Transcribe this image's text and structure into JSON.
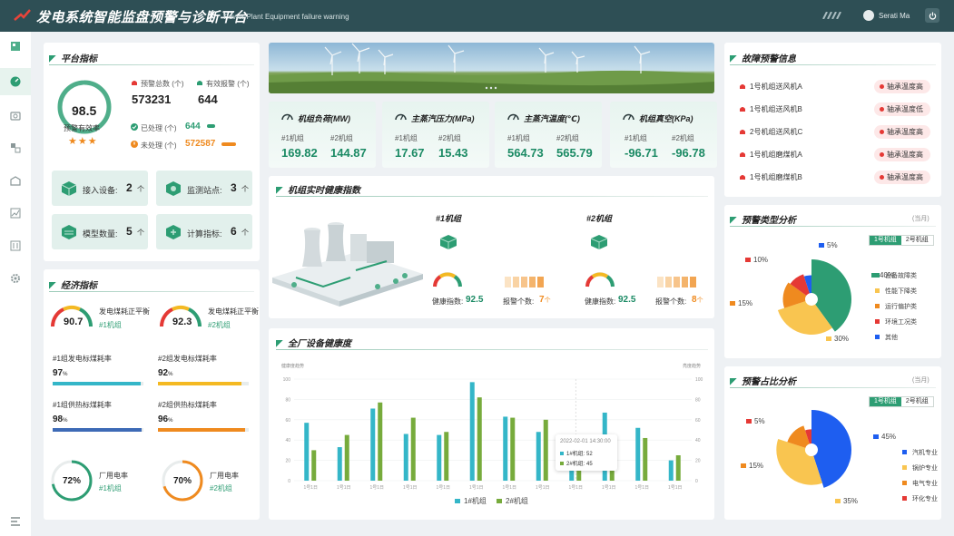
{
  "header": {
    "title": "发电系统智能监盘预警与诊断平台",
    "subtitle": "-Power Plant Equipment failure warning",
    "user": "Serati Ma"
  },
  "sidebar": {
    "icons": [
      "logo-icon",
      "dashboard-icon",
      "camera-icon",
      "flow-icon",
      "chart-icon",
      "trend-icon",
      "report-icon",
      "settings-icon",
      "menu-icon"
    ]
  },
  "platform": {
    "title": "平台指标",
    "gauge_value": "98.5",
    "gauge_label": "预警有效率",
    "stars": "★★★",
    "total_label": "预警总数 (个)",
    "total_value": "573231",
    "valid_label": "有效报警 (个)",
    "valid_value": "644",
    "handled_label": "已处理 (个)",
    "handled_value": "644",
    "unhandled_label": "未处理 (个)",
    "unhandled_value": "572587",
    "tiles": [
      {
        "label": "接入设备:",
        "value": "2",
        "unit": "个"
      },
      {
        "label": "监测站点:",
        "value": "3",
        "unit": "个"
      },
      {
        "label": "模型数量:",
        "value": "5",
        "unit": "个"
      },
      {
        "label": "计算指标:",
        "value": "6",
        "unit": "个"
      }
    ]
  },
  "economy": {
    "title": "经济指标",
    "gauges": [
      {
        "value": "90.7",
        "label": "发电煤耗正平衡",
        "unit_label": "#1机组"
      },
      {
        "value": "92.3",
        "label": "发电煤耗正平衡",
        "unit_label": "#2机组"
      }
    ],
    "bars": [
      {
        "label": "#1组发电标煤耗率",
        "value": "97",
        "unit": "%",
        "pct": 97,
        "color": "#34b6c8"
      },
      {
        "label": "#2组发电标煤耗率",
        "value": "92",
        "unit": "%",
        "pct": 92,
        "color": "#f4b922"
      },
      {
        "label": "#1组供热标煤耗率",
        "value": "98",
        "unit": "%",
        "pct": 98,
        "color": "#3d6ab6"
      },
      {
        "label": "#2组供热标煤耗率",
        "value": "96",
        "unit": "%",
        "pct": 96,
        "color": "#ef8a1f"
      }
    ],
    "rings": [
      {
        "value": "72%",
        "pct": 72,
        "label": "厂用电率",
        "unit_label": "#1机组",
        "color": "#2d9d73"
      },
      {
        "value": "70%",
        "pct": 70,
        "label": "厂用电率",
        "unit_label": "#2机组",
        "color": "#ef8a1f"
      }
    ]
  },
  "metrics": [
    {
      "title": "机组负荷(MW)",
      "u1": "#1机组",
      "v1": "169.82",
      "u2": "#2机组",
      "v2": "144.87"
    },
    {
      "title": "主蒸汽压力(MPa)",
      "u1": "#1机组",
      "v1": "17.67",
      "u2": "#2机组",
      "v2": "15.43"
    },
    {
      "title": "主蒸汽温度(℃)",
      "u1": "#1机组",
      "v1": "564.73",
      "u2": "#2机组",
      "v2": "565.79"
    },
    {
      "title": "机组真空(KPa)",
      "u1": "#1机组",
      "v1": "-96.71",
      "u2": "#2机组",
      "v2": "-96.78"
    }
  ],
  "health": {
    "title": "机组实时健康指数",
    "units": [
      {
        "name": "#1机组",
        "health_label": "健康指数:",
        "health_value": "92.5",
        "warn_label": "报警个数:",
        "warn_value": "7",
        "warn_unit": "个"
      },
      {
        "name": "#2机组",
        "health_label": "健康指数:",
        "health_value": "92.5",
        "warn_label": "报警个数:",
        "warn_value": "8",
        "warn_unit": "个"
      }
    ]
  },
  "plant_chart": {
    "title": "全厂设备健康度",
    "left_axis": "健康度趋势",
    "right_axis": "亮度趋势",
    "tooltip": {
      "date": "2022-02-01 14:30:00",
      "r1": "1#机组: 52",
      "r2": "2#机组: 45"
    }
  },
  "alarms": {
    "title": "故障预警信息",
    "items": [
      {
        "name": "1号机组送风机A",
        "badge": "轴承温度高"
      },
      {
        "name": "1号机组送风机B",
        "badge": "轴承温度低"
      },
      {
        "name": "2号机组送风机C",
        "badge": "轴承温度高"
      },
      {
        "name": "1号机组磨煤机A",
        "badge": "轴承温度高"
      },
      {
        "name": "1号机组磨煤机B",
        "badge": "轴承温度高"
      }
    ]
  },
  "alarm_type": {
    "title": "预警类型分析",
    "period": "(当月)",
    "tab1": "1号机组",
    "tab2": "2号机组"
  },
  "alarm_share": {
    "title": "预警占比分析",
    "period": "(当月)",
    "tab1": "1号机组",
    "tab2": "2号机组"
  },
  "chart_data": [
    {
      "type": "bar",
      "title": "全厂设备健康度",
      "categories": [
        "1号1日",
        "1号1日",
        "1号1日",
        "1号1日",
        "1号1日",
        "1号1日",
        "1号1日",
        "1号1日",
        "1号1日",
        "1号1日",
        "1号1日",
        "1号1日"
      ],
      "series": [
        {
          "name": "1#机组",
          "values": [
            57,
            33,
            71,
            46,
            45,
            97,
            63,
            48,
            35,
            67,
            52,
            20
          ]
        },
        {
          "name": "2#机组",
          "values": [
            30,
            45,
            77,
            62,
            48,
            82,
            62,
            60,
            45,
            45,
            42,
            25
          ]
        }
      ],
      "ylim": [
        0,
        100
      ],
      "yticks": [
        0,
        20,
        40,
        60,
        80,
        100
      ],
      "legend": "bottom",
      "colors": [
        "#34b6c8",
        "#77ab3c"
      ]
    },
    {
      "type": "pie",
      "title": "预警类型分析",
      "labels": [
        "设备故障类",
        "性能下降类",
        "运行偏护类",
        "环境工况类",
        "其他"
      ],
      "values": [
        40,
        30,
        15,
        10,
        5
      ],
      "colors": [
        "#2d9d73",
        "#f9c550",
        "#ef8a1f",
        "#e53935",
        "#1e5ef0"
      ]
    },
    {
      "type": "pie",
      "title": "预警占比分析",
      "labels": [
        "汽机专业",
        "锅炉专业",
        "电气专业",
        "环化专业"
      ],
      "values": [
        45,
        35,
        15,
        5
      ],
      "colors": [
        "#1e5ef0",
        "#f9c550",
        "#ef8a1f",
        "#e53935"
      ]
    }
  ]
}
